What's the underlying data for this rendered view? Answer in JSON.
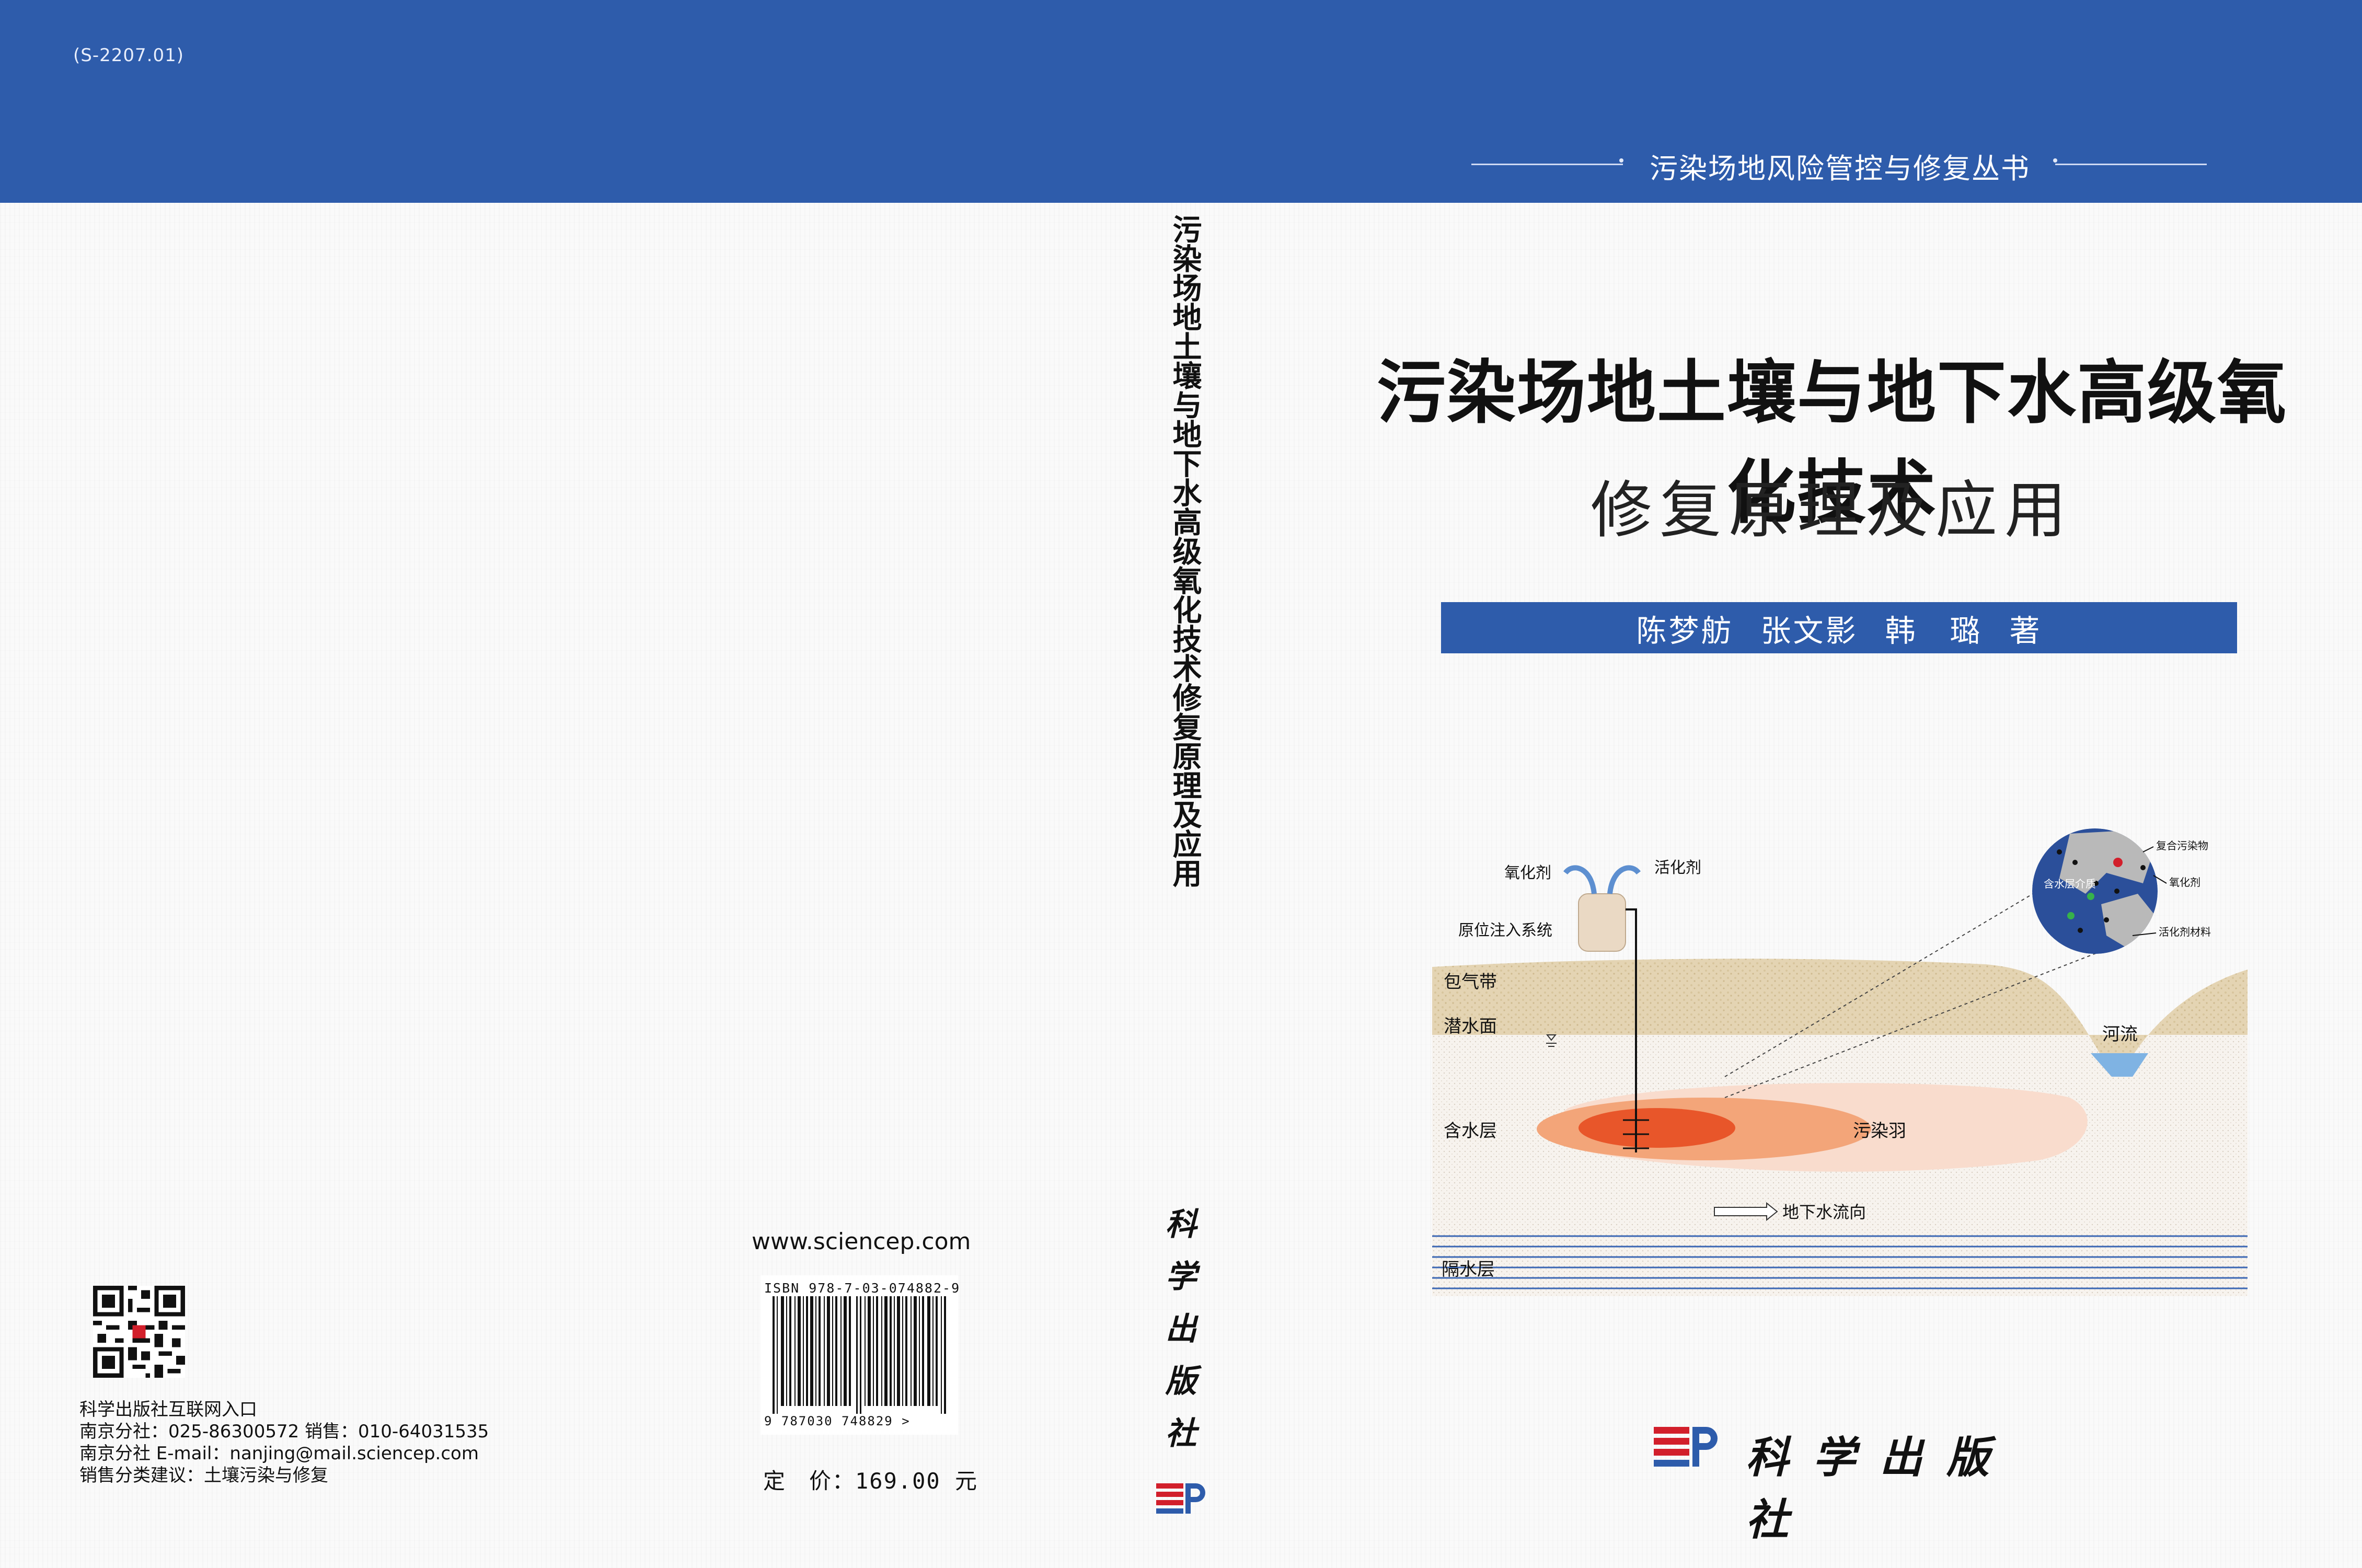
{
  "header": {
    "code": "(S-2207.01)",
    "series": "污染场地风险管控与修复丛书"
  },
  "book": {
    "title": "污染场地土壤与地下水高级氧化技术",
    "subtitle": "修复原理及应用",
    "authors": [
      "陈梦舫",
      "张文影",
      "韩　璐",
      "著"
    ],
    "spine_title": "污染场地土壤与地下水高级氧化技术修复原理及应用",
    "publisher": "科学出版社"
  },
  "illustration": {
    "oxidant": "氧化剂",
    "activator": "活化剂",
    "injection_system": "原位注入系统",
    "vadose_zone": "包气带",
    "water_table": "潜水面",
    "aquifer": "含水层",
    "plume": "污染羽",
    "river": "河流",
    "flow_direction": "地下水流向",
    "aquitard": "隔水层",
    "inset_medium": "含水层介质",
    "inset_contaminant": "复合污染物",
    "inset_oxidant": "氧化剂",
    "inset_activator_material": "活化剂材料"
  },
  "back": {
    "website": "www.sciencep.com",
    "isbn": "ISBN 978-7-03-074882-9",
    "barcode_digits": "9 787030 748829 >",
    "price": "定　价：169.00 元",
    "info": [
      "科学出版社互联网入口",
      "南京分社：025-86300572  销售：010-64031535",
      "南京分社 E-mail：nanjing@mail.sciencep.com",
      "销售分类建议：土壤污染与修复"
    ]
  },
  "colors": {
    "band_blue": "#2e5cab",
    "plume_core": "#e8562a",
    "plume_mid": "#f3a579",
    "plume_outer": "#f9dccd"
  }
}
